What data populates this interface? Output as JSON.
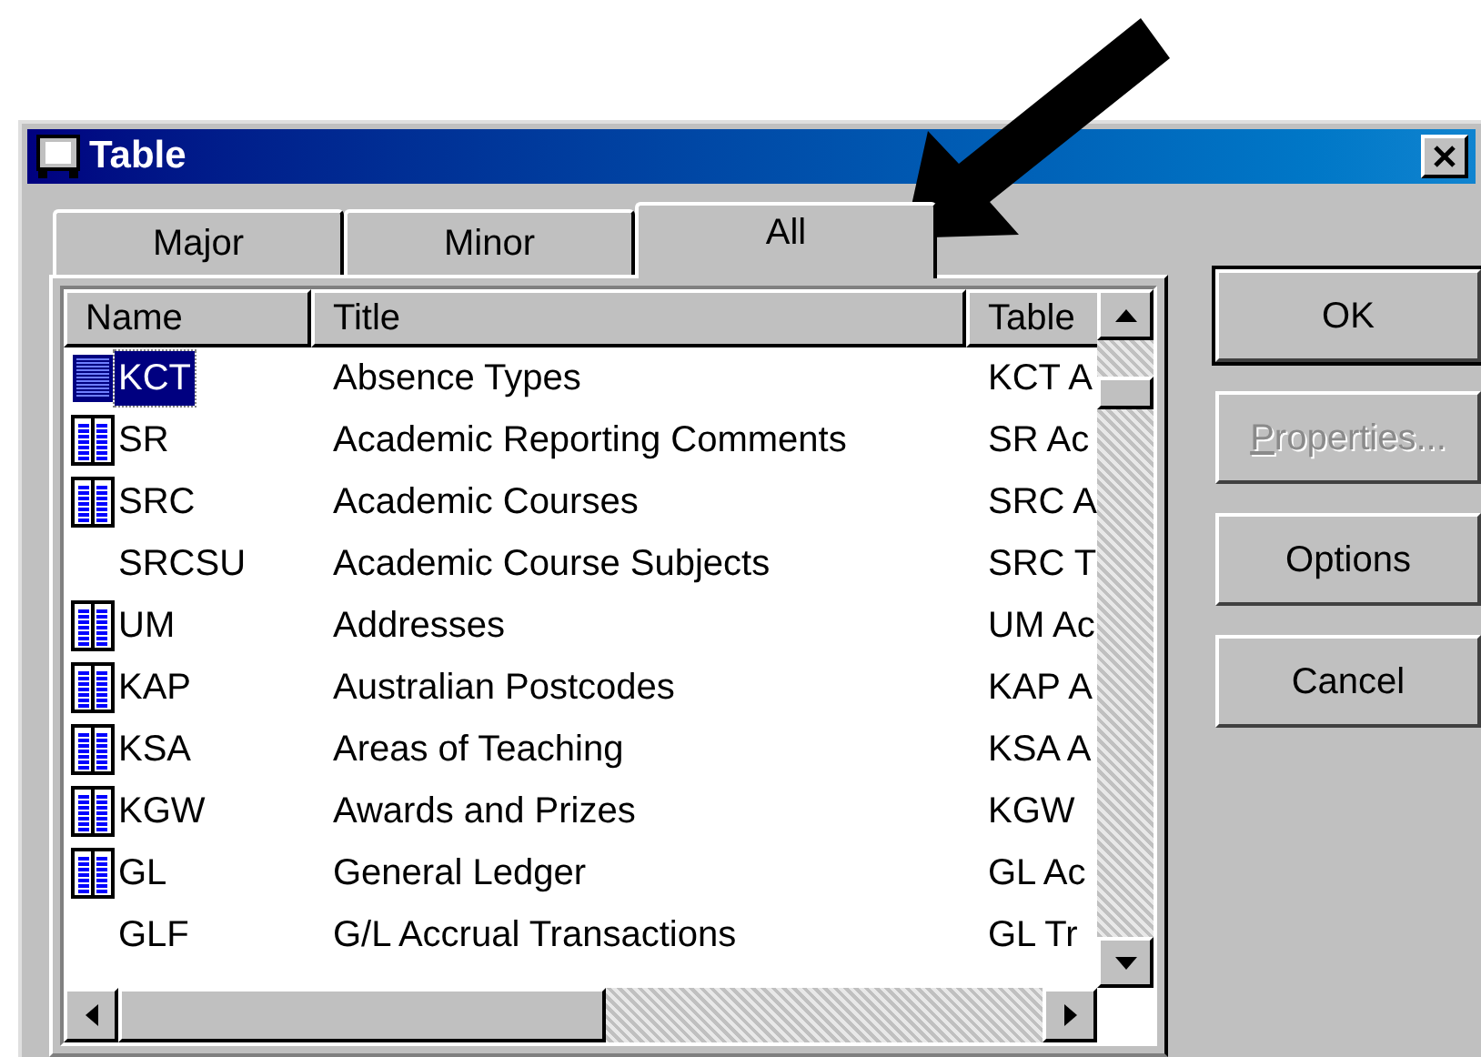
{
  "window": {
    "title": "Table"
  },
  "tabs": [
    {
      "label": "Major",
      "selected": false
    },
    {
      "label": "Minor",
      "selected": false
    },
    {
      "label": "All",
      "selected": true
    }
  ],
  "table": {
    "columns": [
      "Name",
      "Title",
      "Table"
    ],
    "rows": [
      {
        "icon": true,
        "selected": true,
        "cells": [
          "KCT",
          "Absence Types",
          "KCT A"
        ]
      },
      {
        "icon": true,
        "selected": false,
        "cells": [
          "SR",
          "Academic Reporting Comments",
          "SR Ac"
        ]
      },
      {
        "icon": true,
        "selected": false,
        "cells": [
          "SRC",
          "Academic Courses",
          "SRC A"
        ]
      },
      {
        "icon": false,
        "selected": false,
        "cells": [
          "SRCSU",
          "Academic Course Subjects",
          "SRC T"
        ]
      },
      {
        "icon": true,
        "selected": false,
        "cells": [
          "UM",
          "Addresses",
          "UM Ac"
        ]
      },
      {
        "icon": true,
        "selected": false,
        "cells": [
          "KAP",
          "Australian Postcodes",
          "KAP A"
        ]
      },
      {
        "icon": true,
        "selected": false,
        "cells": [
          "KSA",
          "Areas of Teaching",
          "KSA A"
        ]
      },
      {
        "icon": true,
        "selected": false,
        "cells": [
          "KGW",
          "Awards and Prizes",
          "KGW"
        ]
      },
      {
        "icon": true,
        "selected": false,
        "cells": [
          "GL",
          "General Ledger",
          "GL Ac"
        ]
      },
      {
        "icon": false,
        "selected": false,
        "cells": [
          "GLF",
          "G/L Accrual Transactions",
          "GL Tr"
        ]
      }
    ]
  },
  "buttons": [
    {
      "label": "OK",
      "default": true,
      "disabled": false,
      "underline_first": false
    },
    {
      "label": "Properties...",
      "default": false,
      "disabled": true,
      "underline_first": true
    },
    {
      "label": "Options",
      "default": false,
      "disabled": false,
      "underline_first": false
    },
    {
      "label": "Cancel",
      "default": false,
      "disabled": false,
      "underline_first": false
    }
  ]
}
